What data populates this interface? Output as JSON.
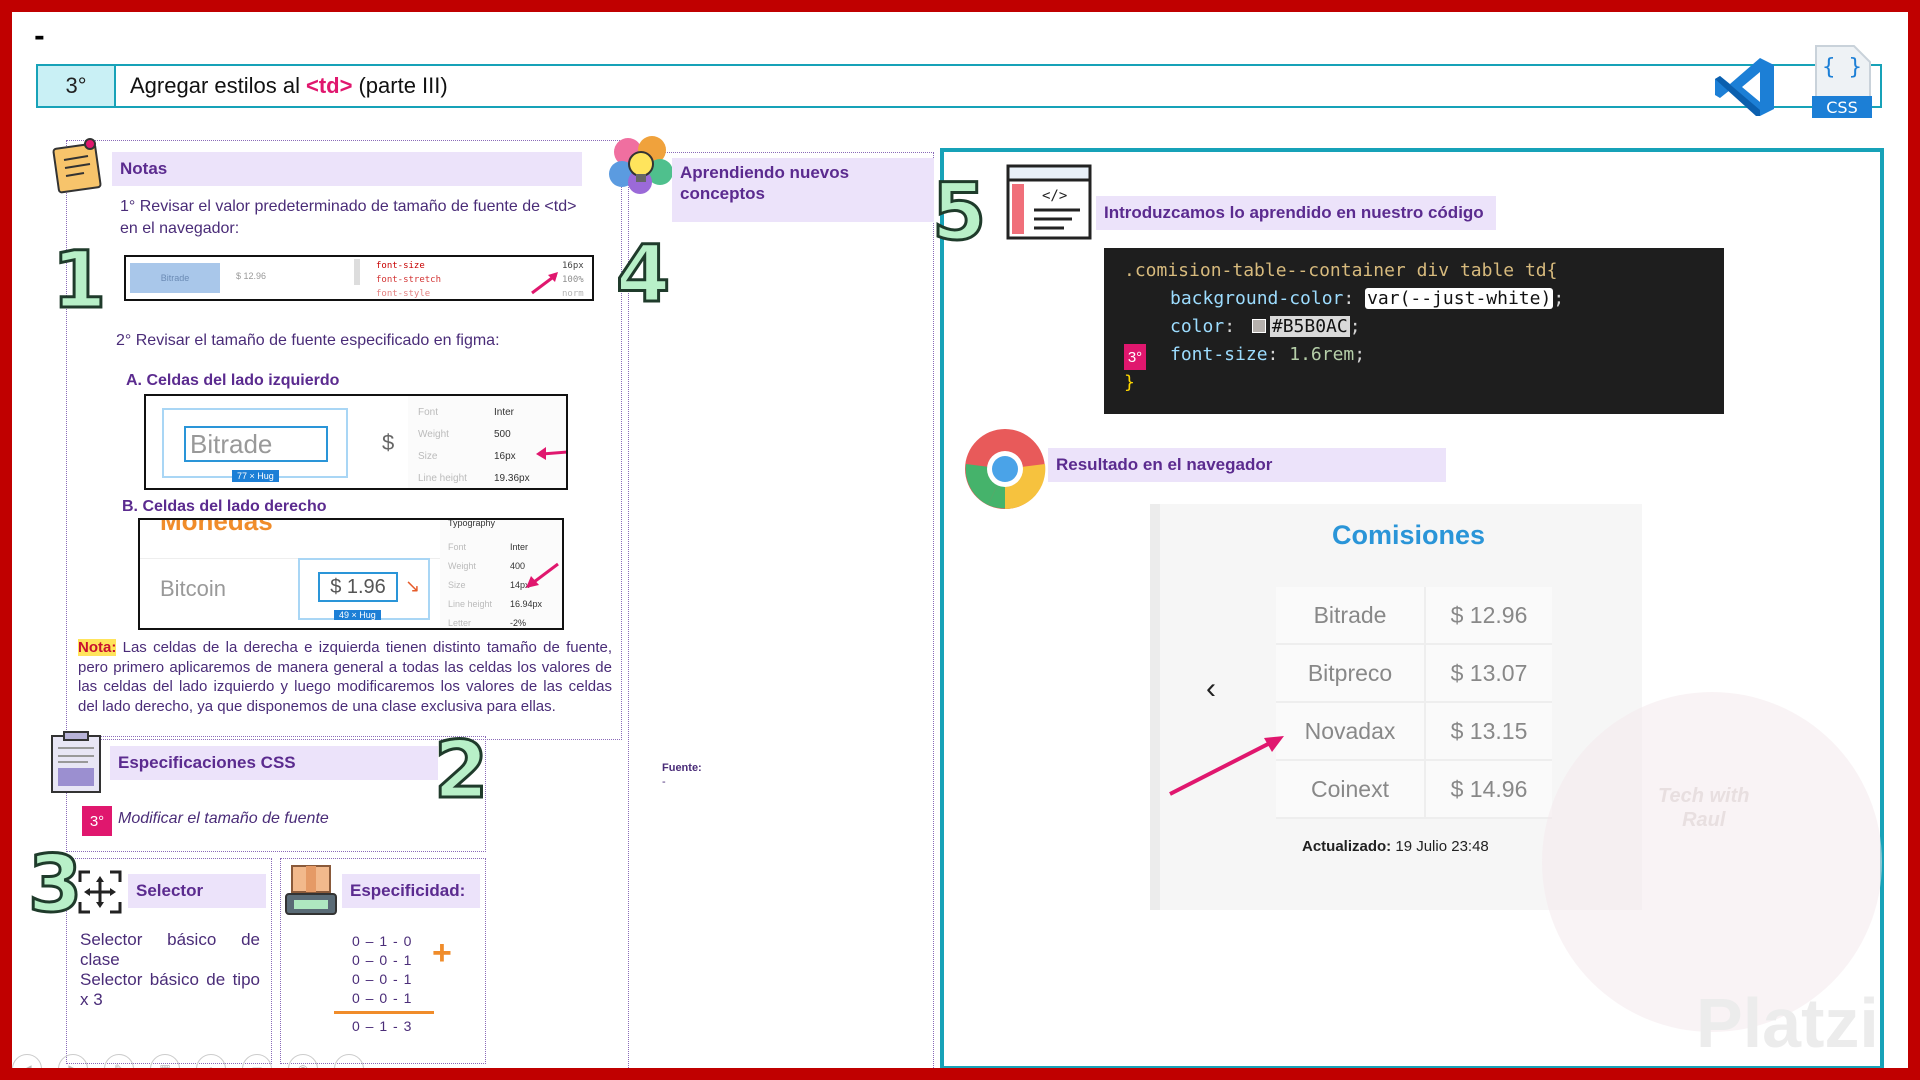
{
  "slide": {
    "dash": "-",
    "step_number": "3°",
    "title_prefix": "Agregar estilos al",
    "title_tag": "<td>",
    "title_suffix": "(parte III)",
    "css_badge": "CSS",
    "css_braces": "{ }"
  },
  "notas": {
    "header": "Notas",
    "item1": "1° Revisar el valor predeterminado de tamaño de fuente de <td> en el navegador:",
    "devtools": {
      "cell_left": "Bitrade",
      "cell_right": "$ 12.96",
      "props": [
        "font-size",
        "font-stretch",
        "font-style"
      ],
      "vals": [
        "16px",
        "100%",
        "norm"
      ]
    },
    "item2": "2° Revisar el tamaño de fuente especificado en figma:",
    "a_label": "A. Celdas del lado izquierdo",
    "figma_a": {
      "cell": "Bitrade",
      "dollar": "$",
      "hug": "77 × Hug",
      "rows": [
        {
          "k": "Font",
          "v": "Inter"
        },
        {
          "k": "Weight",
          "v": "500"
        },
        {
          "k": "Size",
          "v": "16px"
        },
        {
          "k": "Line height",
          "v": "19.36px"
        }
      ]
    },
    "b_label": "B. Celdas del lado derecho",
    "figma_b": {
      "top": "Monedas",
      "cell_left": "Bitcoin",
      "cell_right": "$ 1.96",
      "hug": "49 × Hug",
      "typo": "Typography",
      "rows": [
        {
          "k": "Font",
          "v": "Inter"
        },
        {
          "k": "Weight",
          "v": "400"
        },
        {
          "k": "Size",
          "v": "14px"
        },
        {
          "k": "Line height",
          "v": "16.94px"
        },
        {
          "k": "Letter",
          "v": "-2%"
        }
      ]
    },
    "nota_label": "Nota:",
    "nota_text": "Las celdas de la derecha e izquierda tienen distinto tamaño de fuente, pero primero aplicaremos de manera general a todas las celdas los valores de las celdas del lado izquierdo y luego modificaremos los valores de las celdas del lado derecho, ya que disponemos de una clase exclusiva para ellas."
  },
  "specs": {
    "header": "Especificaciones CSS",
    "badge": "3°",
    "item": "Modificar el tamaño de fuente"
  },
  "selector": {
    "header": "Selector",
    "line1": "Selector básico de clase",
    "line2": "Selector básico de tipo x 3"
  },
  "specificity": {
    "header": "Especificidad:",
    "rows": [
      "0 – 1 - 0",
      "0 – 0 - 1",
      "0 – 0 - 1",
      "0 – 0 - 1"
    ],
    "plus": "+",
    "total": "0 – 1 - 3"
  },
  "aprendiendo": {
    "header": "Aprendiendo nuevos conceptos",
    "fuente_label": "Fuente:",
    "fuente_value": "-"
  },
  "codigo": {
    "header": "Introduzcamos lo aprendido en nuestro código",
    "selector": ".comision-table--container div table td{",
    "p1_name": "background-color",
    "p1_value": "var(--just-white)",
    "p2_name": "color",
    "p2_value": "#B5B0AC",
    "p3_name": "font-size",
    "p3_value": "1.6rem",
    "badge": "3°",
    "close": "}",
    "swatch_color": "#B5B0AC"
  },
  "resultado": {
    "header": "Resultado en el navegador",
    "title": "Comisiones",
    "rows": [
      {
        "name": "Bitrade",
        "value": "$ 12.96"
      },
      {
        "name": "Bitpreco",
        "value": "$ 13.07"
      },
      {
        "name": "Novadax",
        "value": "$ 13.15"
      },
      {
        "name": "Coinext",
        "value": "$ 14.96"
      }
    ],
    "updated_label": "Actualizado:",
    "updated_value": "19 Julio 23:48",
    "back": "‹",
    "watermark_line1": "Tech with",
    "watermark_line2": "Raul"
  },
  "platzi": "Platzi",
  "colors": {
    "frame": "#c00000",
    "accent": "#e0176e",
    "teal": "#17a2b8",
    "header_bg": "#ece3fa",
    "header_text": "#5b2b8f",
    "vscode": "#1c7fd6",
    "comisiones": "#2a95d8"
  },
  "icons": [
    "sticky-note-icon",
    "brain-lightbulb-icon",
    "code-window-icon",
    "chrome-icon",
    "clipboard-icon",
    "move-icon",
    "scale-icon",
    "vscode-icon",
    "css-file-icon"
  ]
}
